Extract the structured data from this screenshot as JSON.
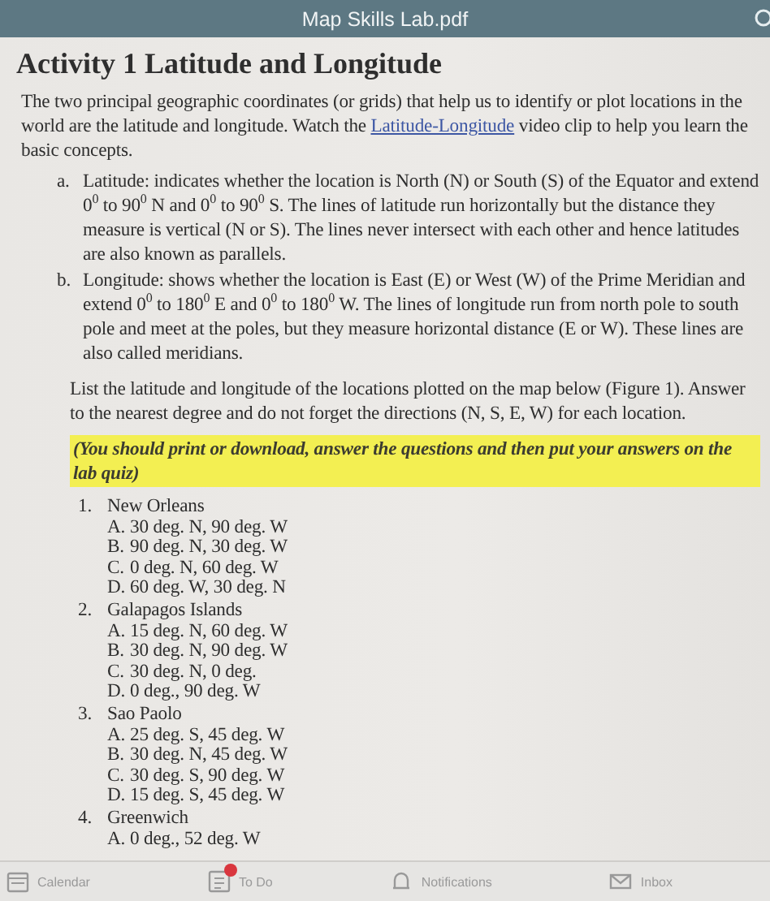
{
  "window": {
    "title": "Map Skills Lab.pdf"
  },
  "document": {
    "heading": "Activity 1 Latitude and Longitude",
    "intro": {
      "before": "The two principal geographic coordinates (or grids) that help us to identify or plot locations in the world are the latitude and longitude. Watch the ",
      "link": "Latitude-Longitude",
      "after": " video clip to help you learn the basic concepts."
    },
    "definitions": [
      {
        "marker": "a.",
        "text": "Latitude: indicates whether the location is North (N) or South (S) of the Equator and extend 0$^{0}$ to 90$^{0}$ N and 0$^{0}$ to 90$^{0}$ S. The lines of latitude run horizontally but the distance they measure is vertical (N or S). The lines never intersect with each other and hence latitudes are also known as parallels."
      },
      {
        "marker": "b.",
        "text": "Longitude: shows whether the location is East (E) or West (W) of the Prime Meridian and extend 0$^{0}$ to 180$^{0}$ E and 0$^{0}$ to 180$^{0}$ W. The lines of longitude run from north pole to south pole and meet at the poles, but they measure horizontal distance (E or W). These lines are also called meridians."
      }
    ],
    "instructions": "List the latitude and longitude of the locations plotted on the map below (Figure 1). Answer to the nearest degree and do not forget the directions (N, S, E, W) for each location.",
    "note": "(You should print or download, answer the questions and then put your answers on the lab quiz)",
    "questions": [
      {
        "number": "1.",
        "place": "New Orleans",
        "options": [
          {
            "letter": "A.",
            "text": "30 deg. N, 90 deg. W"
          },
          {
            "letter": "B.",
            "text": "90 deg. N, 30 deg. W"
          },
          {
            "letter": "C.",
            "text": "0 deg. N, 60 deg. W"
          },
          {
            "letter": "D.",
            "text": "60 deg. W, 30 deg. N"
          }
        ]
      },
      {
        "number": "2.",
        "place": "Galapagos Islands",
        "options": [
          {
            "letter": "A.",
            "text": "15 deg. N, 60 deg. W"
          },
          {
            "letter": "B.",
            "text": "30 deg. N, 90 deg. W"
          },
          {
            "letter": "C.",
            "text": "30 deg. N, 0 deg."
          },
          {
            "letter": "D.",
            "text": "0 deg., 90 deg. W"
          }
        ]
      },
      {
        "number": "3.",
        "place": "Sao Paolo",
        "options": [
          {
            "letter": "A.",
            "text": "25 deg. S, 45 deg. W"
          },
          {
            "letter": "B.",
            "text": "30 deg. N, 45 deg. W"
          },
          {
            "letter": "C.",
            "text": "30 deg. S, 90 deg. W"
          },
          {
            "letter": "D.",
            "text": "15 deg. S, 45 deg. W"
          }
        ]
      },
      {
        "number": "4.",
        "place": "Greenwich",
        "options": [
          {
            "letter": "A.",
            "text": "0 deg., 52 deg. W"
          }
        ]
      }
    ]
  },
  "tab_bar": [
    {
      "kind": "calendar",
      "label": "Calendar",
      "badge": false
    },
    {
      "kind": "todo",
      "label": "To Do",
      "badge": true
    },
    {
      "kind": "bell",
      "label": "Notifications",
      "badge": false
    },
    {
      "kind": "mail",
      "label": "Inbox",
      "badge": false
    }
  ]
}
